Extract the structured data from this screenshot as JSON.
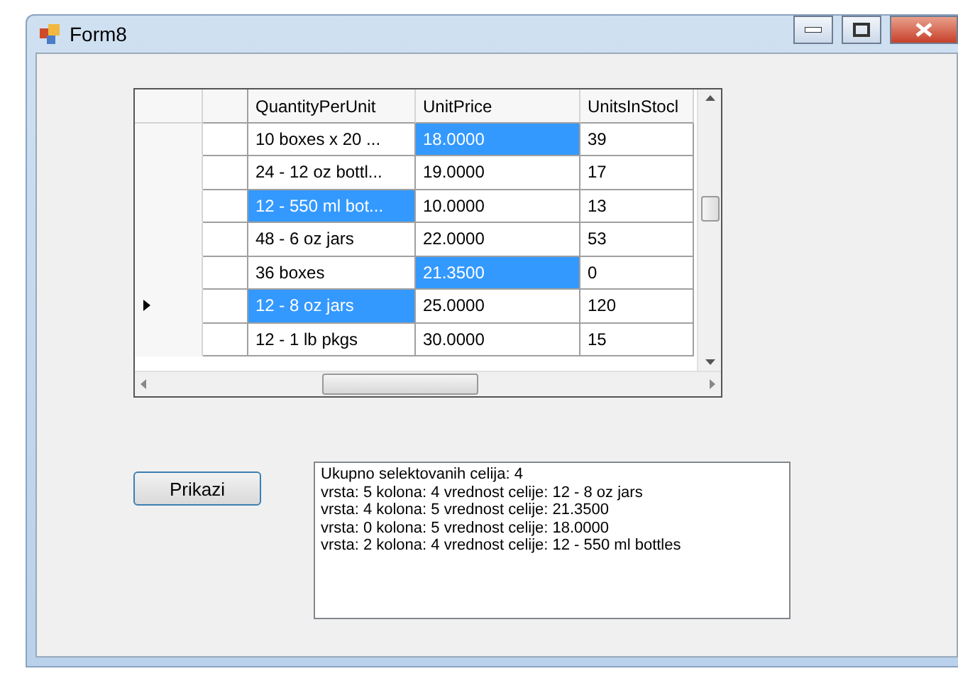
{
  "window": {
    "title": "Form8"
  },
  "grid": {
    "columns": [
      "QuantityPerUnit",
      "UnitPrice",
      "UnitsInStocl"
    ],
    "rows": [
      {
        "current": false,
        "cells": [
          {
            "text": "10 boxes x 20 ...",
            "selected": false
          },
          {
            "text": "18.0000",
            "selected": true
          },
          {
            "text": "39",
            "selected": false
          }
        ]
      },
      {
        "current": false,
        "cells": [
          {
            "text": "24 - 12 oz bottl...",
            "selected": false
          },
          {
            "text": "19.0000",
            "selected": false
          },
          {
            "text": "17",
            "selected": false
          }
        ]
      },
      {
        "current": false,
        "cells": [
          {
            "text": "12 - 550 ml bot...",
            "selected": true
          },
          {
            "text": "10.0000",
            "selected": false
          },
          {
            "text": "13",
            "selected": false
          }
        ]
      },
      {
        "current": false,
        "cells": [
          {
            "text": "48 - 6 oz jars",
            "selected": false
          },
          {
            "text": "22.0000",
            "selected": false
          },
          {
            "text": "53",
            "selected": false
          }
        ]
      },
      {
        "current": false,
        "cells": [
          {
            "text": "36 boxes",
            "selected": false
          },
          {
            "text": "21.3500",
            "selected": true
          },
          {
            "text": "0",
            "selected": false
          }
        ]
      },
      {
        "current": true,
        "cells": [
          {
            "text": "12 - 8 oz jars",
            "selected": true
          },
          {
            "text": "25.0000",
            "selected": false
          },
          {
            "text": "120",
            "selected": false
          }
        ]
      },
      {
        "current": false,
        "cells": [
          {
            "text": "12 - 1 lb pkgs",
            "selected": false
          },
          {
            "text": "30.0000",
            "selected": false
          },
          {
            "text": "15",
            "selected": false
          }
        ]
      }
    ]
  },
  "button": {
    "label": "Prikazi"
  },
  "output": {
    "lines": [
      "Ukupno selektovanih celija: 4",
      "vrsta: 5 kolona: 4 vrednost celije: 12 - 8 oz jars",
      "vrsta: 4 kolona: 5 vrednost celije: 21.3500",
      "vrsta: 0 kolona: 5 vrednost celije: 18.0000",
      "vrsta: 2 kolona: 4 vrednost celije: 12 - 550 ml bottles"
    ]
  }
}
